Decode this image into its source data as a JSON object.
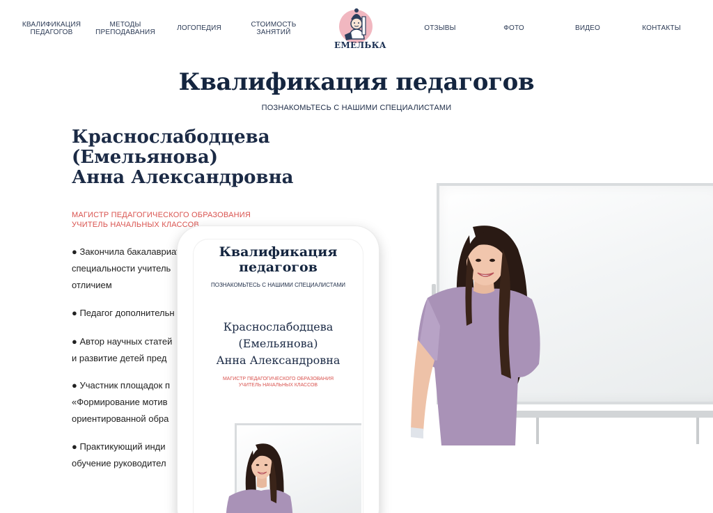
{
  "nav": {
    "items": [
      {
        "label_1": "Квалификация",
        "label_2": "педагогов"
      },
      {
        "label_1": "Методы",
        "label_2": "преподавания"
      },
      {
        "label": "Логопедия"
      },
      {
        "label_1": "Стоимость",
        "label_2": "занятий"
      },
      {
        "label": "Отзывы"
      },
      {
        "label": "Фото"
      },
      {
        "label": "Видео"
      },
      {
        "label": "Контакты"
      }
    ],
    "logo_text": "ЕМЕЛЬКА"
  },
  "page": {
    "title": "Квалификация педагогов",
    "subtitle": "Познакомьтесь с нашими специалистами"
  },
  "teacher": {
    "name_line1": "Краснослабодцева",
    "name_line2": "(Емельянова)",
    "name_line3": "Анна Александровна",
    "role_line1": "Магистр педагогического образования",
    "role_line2": "Учитель начальных классов",
    "bullets": [
      {
        "line1": "●  Закончила бакалавриат",
        "line2": "специальности учитель",
        "line3": "отличием"
      },
      {
        "line1": "●  Педагог дополнительн"
      },
      {
        "line1": "●  Автор научных статей",
        "line2": "и развитие детей пред"
      },
      {
        "line1": "●  Участник площадок п",
        "line2": "«Формирование мотив",
        "line3": "ориентированной обра"
      },
      {
        "line1": "●  Практикующий инди",
        "line2": "обучение руководител"
      }
    ]
  },
  "mobile": {
    "title_line1": "Квалификация",
    "title_line2": "педагогов",
    "subtitle": "Познакомьтесь с нашими специалистами",
    "name_line1": "Краснослабодцева",
    "name_line2": "(Емельянова)",
    "name_line3": "Анна Александровна",
    "role_line1": "Магистр педагогического образования",
    "role_line2": "Учитель начальных классов"
  },
  "colors": {
    "accent_red": "#d9534f",
    "heading_navy": "#14253f",
    "dress_lilac": "#a992b7",
    "logo_pink": "#f1b7c0"
  }
}
